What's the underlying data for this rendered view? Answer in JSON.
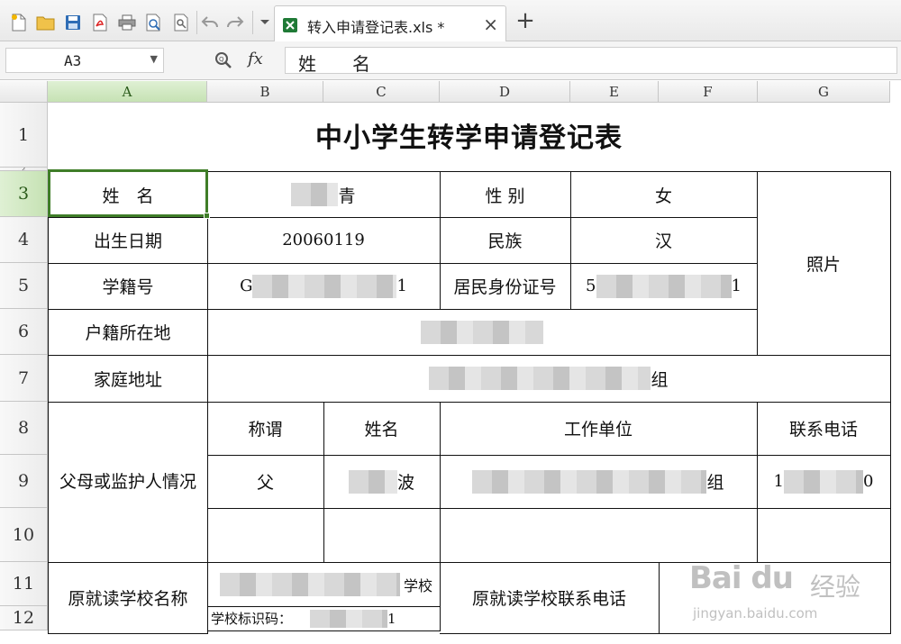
{
  "tab": {
    "filename": "转入申请登记表.xls *",
    "close": "×",
    "add": "+"
  },
  "formula_bar": {
    "cell_ref": "A3",
    "fx": "fx",
    "content": "姓　　名"
  },
  "columns": [
    "A",
    "B",
    "C",
    "D",
    "E",
    "F",
    "G"
  ],
  "rows": [
    "1",
    "3",
    "4",
    "5",
    "6",
    "7",
    "8",
    "9",
    "10",
    "11",
    "12"
  ],
  "hidden_row_mark": "2",
  "sheet": {
    "title": "中小学生转学申请登记表",
    "name_label": "姓　名",
    "name_value_suffix": "青",
    "gender_label": "性  别",
    "gender_value": "女",
    "dob_label": "出生日期",
    "dob_value": "20060119",
    "ethnicity_label": "民族",
    "ethnicity_value": "汉",
    "photo_label": "照片",
    "student_id_label": "学籍号",
    "student_id_prefix": "G",
    "student_id_suffix": "1",
    "citizen_id_label": "居民身份证号",
    "citizen_id_prefix": "5",
    "citizen_id_suffix": "1",
    "hukou_label": "户籍所在地",
    "address_label": "家庭地址",
    "address_suffix": "组",
    "guardian_label": "父母或监护人情况",
    "guardian_headers": {
      "relation": "称谓",
      "name": "姓名",
      "workplace": "工作单位",
      "phone": "联系电话"
    },
    "guardian_row": {
      "relation": "父",
      "name_suffix": "波",
      "workplace_suffix": "组",
      "phone_prefix": "1",
      "phone_suffix": "0"
    },
    "prev_school_label": "原就读学校名称",
    "prev_school_suffix": "学校",
    "school_code_label": "学校标识码：",
    "school_code_suffix": "1",
    "prev_school_phone_label": "原就读学校联系电话"
  },
  "watermark": {
    "logo": "Bai du",
    "cn": "经验",
    "url": "jingyan.baidu.com"
  }
}
